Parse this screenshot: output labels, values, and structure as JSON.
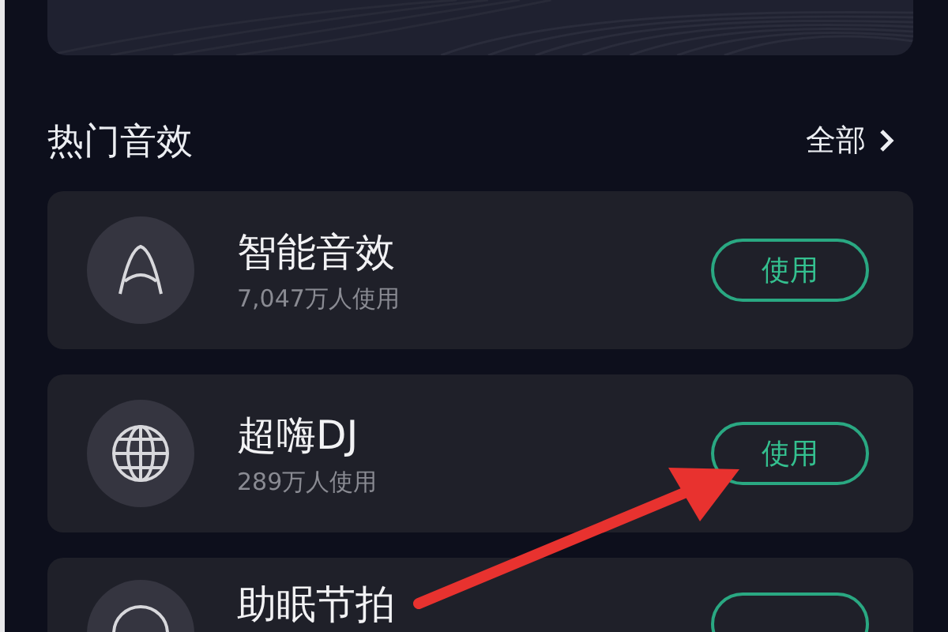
{
  "section": {
    "title": "热门音效",
    "more_link": "全部"
  },
  "effects": [
    {
      "kind": "letter",
      "title": "智能音效",
      "users": "7,047万人使用",
      "button": "使用"
    },
    {
      "kind": "globe",
      "title": "超嗨DJ",
      "users": "289万人使用",
      "button": "使用"
    },
    {
      "kind": "moon",
      "title": "助眠节拍"
    }
  ]
}
